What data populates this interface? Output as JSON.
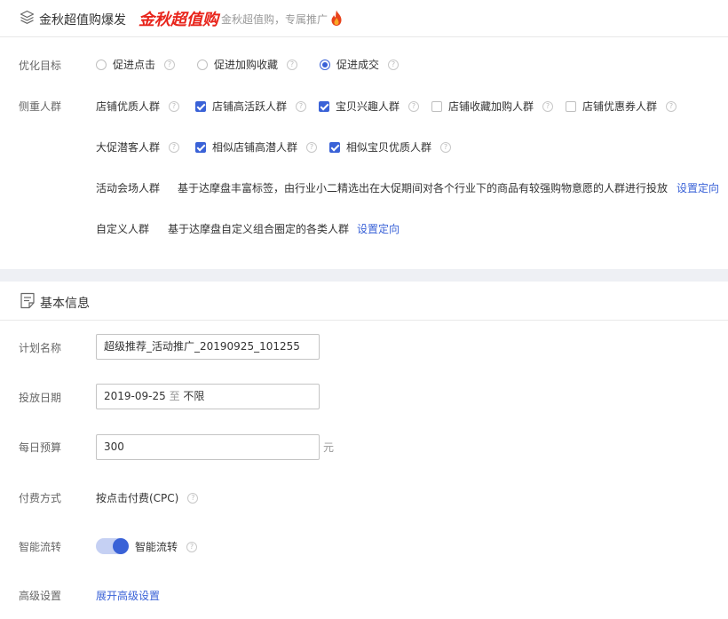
{
  "header": {
    "title": "金秋超值购爆发",
    "logo_text": "金秋超值购",
    "subtitle": "金秋超值购，专属推广"
  },
  "optimize": {
    "label": "优化目标",
    "options": [
      {
        "label": "促进点击",
        "selected": false
      },
      {
        "label": "促进加购收藏",
        "selected": false
      },
      {
        "label": "促进成交",
        "selected": true
      }
    ]
  },
  "audience": {
    "label": "侧重人群",
    "shop_group": {
      "label": "店铺优质人群",
      "options": [
        {
          "label": "店铺高活跃人群",
          "checked": true
        },
        {
          "label": "宝贝兴趣人群",
          "checked": true
        },
        {
          "label": "店铺收藏加购人群",
          "checked": false
        },
        {
          "label": "店铺优惠券人群",
          "checked": false
        }
      ]
    },
    "promo_group": {
      "label": "大促潜客人群",
      "options": [
        {
          "label": "相似店铺高潜人群",
          "checked": true
        },
        {
          "label": "相似宝贝优质人群",
          "checked": true
        }
      ]
    },
    "venue_group": {
      "label": "活动会场人群",
      "desc": "基于达摩盘丰富标签，由行业小二精选出在大促期间对各个行业下的商品有较强购物意愿的人群进行投放",
      "link": "设置定向"
    },
    "custom_group": {
      "label": "自定义人群",
      "desc": "基于达摩盘自定义组合圈定的各类人群",
      "link": "设置定向"
    }
  },
  "basic": {
    "title": "基本信息",
    "plan_name": {
      "label": "计划名称",
      "value": "超级推荐_活动推广_20190925_101255"
    },
    "dates": {
      "label": "投放日期",
      "start": "2019-09-25",
      "sep": "至",
      "end": "不限"
    },
    "budget": {
      "label": "每日预算",
      "value": "300",
      "unit": "元"
    },
    "payment": {
      "label": "付费方式",
      "value": "按点击付费(CPC)"
    },
    "smart_flow": {
      "label": "智能流转",
      "toggle_label": "智能流转",
      "on": true
    },
    "advanced": {
      "label": "高级设置",
      "link": "展开高级设置"
    }
  },
  "colors": {
    "accent": "#3a62d7",
    "brand_red": "#e8241b"
  }
}
